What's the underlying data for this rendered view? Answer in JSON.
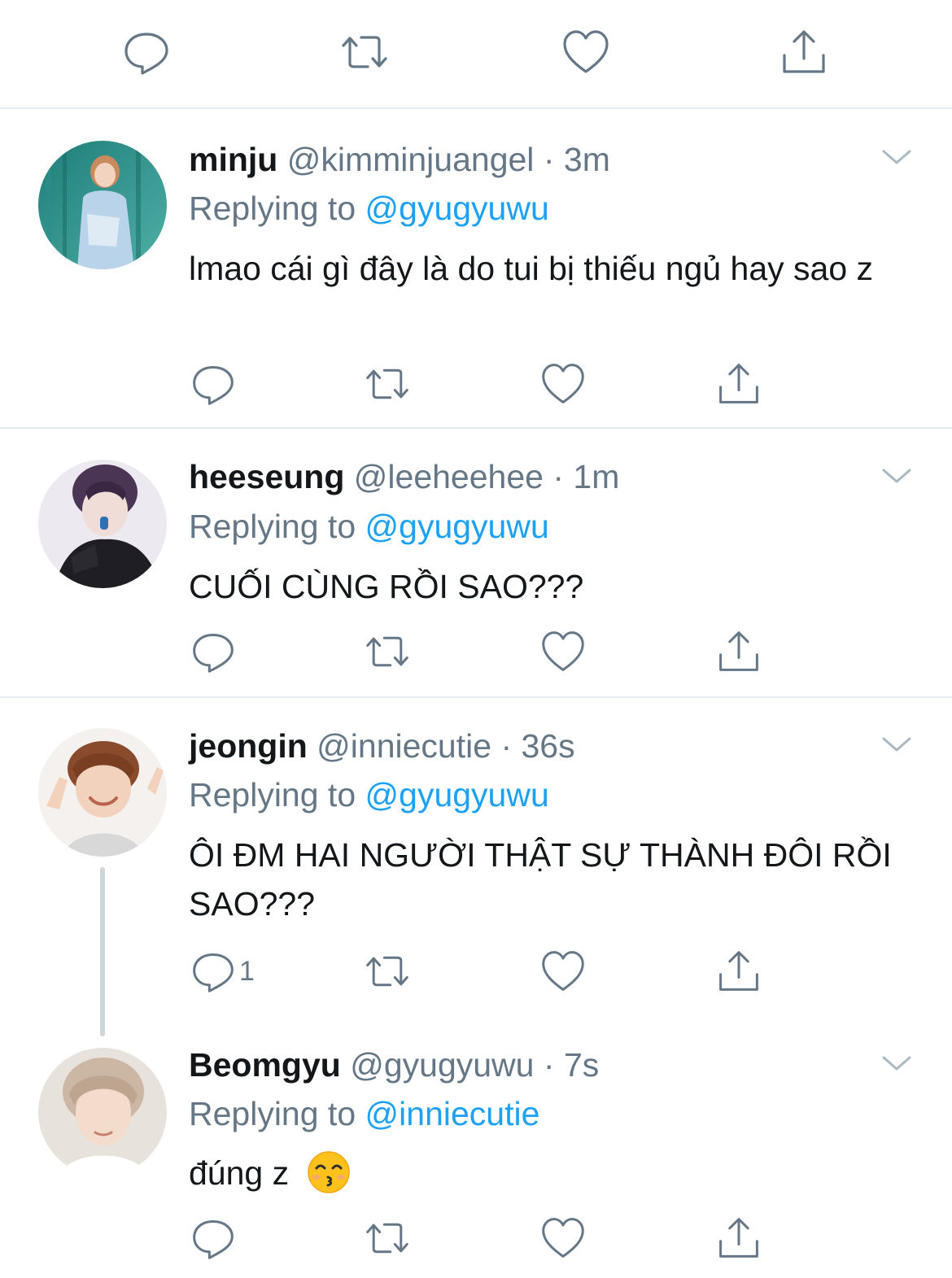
{
  "top_actions": {
    "reply_icon": "reply-icon",
    "retweet_icon": "retweet-icon",
    "like_icon": "heart-icon",
    "share_icon": "share-icon"
  },
  "tweets": [
    {
      "name": "minju",
      "handle": "@kimminjuangel",
      "separator": "·",
      "time": "3m",
      "replying_prefix": "Replying to",
      "replying_to": "@gyugyuwu",
      "text": "lmao cái gì đây là do tui bị thiếu ngủ hay sao z",
      "reply_count": ""
    },
    {
      "name": "heeseung",
      "handle": "@leeheehee",
      "separator": "·",
      "time": "1m",
      "replying_prefix": "Replying to",
      "replying_to": "@gyugyuwu",
      "text": "CUỐI CÙNG RỒI SAO???",
      "reply_count": ""
    },
    {
      "name": "jeongin",
      "handle": "@inniecutie",
      "separator": "·",
      "time": "36s",
      "replying_prefix": "Replying to",
      "replying_to": "@gyugyuwu",
      "text": "ÔI ĐM HAI NGƯỜI THẬT SỰ THÀNH ĐÔI RỒI SAO???",
      "reply_count": "1"
    },
    {
      "name": "Beomgyu",
      "handle": "@gyugyuwu",
      "separator": "·",
      "time": "7s",
      "replying_prefix": "Replying to",
      "replying_to": "@inniecutie",
      "text": "đúng z",
      "emoji": "kissing-smiling-eyes-emoji",
      "reply_count": ""
    }
  ],
  "colors": {
    "accent": "#1da1f2",
    "muted": "#657786",
    "divider": "#e6ecf0",
    "text": "#14171a"
  }
}
